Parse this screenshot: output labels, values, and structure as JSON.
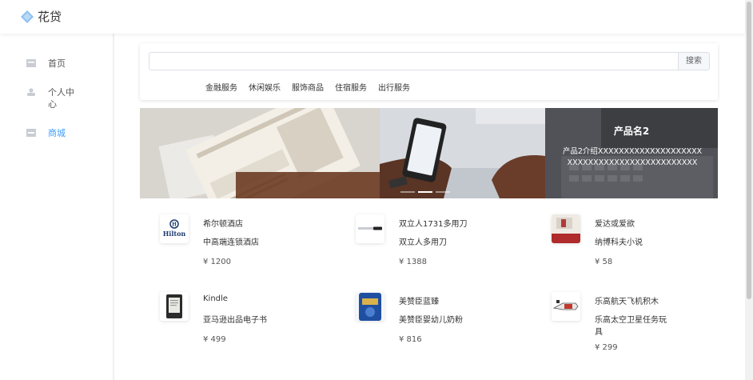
{
  "app": {
    "title": "花贷"
  },
  "sidebar": {
    "items": [
      {
        "label": "首页",
        "icon": "home-icon",
        "active": false
      },
      {
        "label": "个人中心",
        "icon": "user-icon",
        "active": false
      },
      {
        "label": "商城",
        "icon": "shop-icon",
        "active": true
      }
    ]
  },
  "search": {
    "value": "",
    "placeholder": "",
    "button_label": "搜索",
    "categories": [
      "金融服务",
      "休闲娱乐",
      "服饰商品",
      "住宿服务",
      "出行服务"
    ]
  },
  "banner": {
    "title": "产品名2",
    "description": "产品2介绍XXXXXXXXXXXXXXXXXXXXXXXXXXXXXXXXXXXXXXXXXXXXX",
    "active_slide": 2,
    "slides": 3
  },
  "products": [
    {
      "name": "希尔顿酒店",
      "desc": "中高端连锁酒店",
      "price": "¥ 1200",
      "icon": "hilton-logo-icon"
    },
    {
      "name": "双立人1731多用刀",
      "desc": "双立人多用刀",
      "price": "¥ 1388",
      "icon": "knife-icon"
    },
    {
      "name": "爱达或爱欲",
      "desc": "纳博科夫小说",
      "price": "¥ 58",
      "icon": "book-icon"
    },
    {
      "name": "Kindle",
      "desc": "亚马逊出品电子书",
      "price": "¥ 499",
      "icon": "kindle-icon"
    },
    {
      "name": "美赞臣蓝臻",
      "desc": "美赞臣婴幼儿奶粉",
      "price": "¥ 816",
      "icon": "milk-powder-icon"
    },
    {
      "name": "乐高航天飞机积木",
      "desc": "乐高太空卫星任务玩具",
      "price": "¥ 299",
      "icon": "lego-shuttle-icon"
    }
  ],
  "colors": {
    "accent": "#409eff",
    "text": "#333333",
    "banner_overlay": "#4b4d52"
  }
}
